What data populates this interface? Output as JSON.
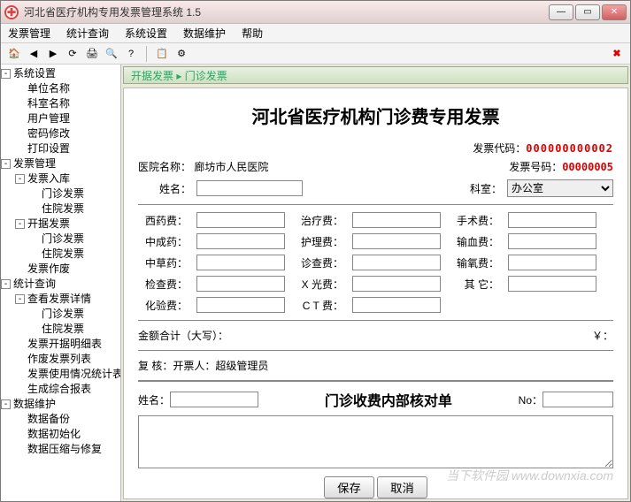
{
  "window": {
    "title": "河北省医疗机构专用发票管理系统 1.5",
    "icon_glyph": "✚"
  },
  "menu": [
    "发票管理",
    "统计查询",
    "系统设置",
    "数据维护",
    "帮助"
  ],
  "toolbar_icons": [
    "home-icon",
    "back-icon",
    "forward-icon",
    "refresh-icon",
    "print-icon",
    "find-icon",
    "help-icon",
    "sep",
    "tool-a",
    "tool-b"
  ],
  "close_icon_right": "✖",
  "tree": [
    {
      "lvl": 0,
      "label": "系统设置",
      "exp": "-"
    },
    {
      "lvl": 1,
      "label": "单位名称"
    },
    {
      "lvl": 1,
      "label": "科室名称"
    },
    {
      "lvl": 1,
      "label": "用户管理"
    },
    {
      "lvl": 1,
      "label": "密码修改"
    },
    {
      "lvl": 1,
      "label": "打印设置"
    },
    {
      "lvl": 0,
      "label": "发票管理",
      "exp": "-"
    },
    {
      "lvl": 1,
      "label": "发票入库",
      "exp": "-"
    },
    {
      "lvl": 2,
      "label": "门诊发票"
    },
    {
      "lvl": 2,
      "label": "住院发票"
    },
    {
      "lvl": 1,
      "label": "开据发票",
      "exp": "-"
    },
    {
      "lvl": 2,
      "label": "门诊发票"
    },
    {
      "lvl": 2,
      "label": "住院发票"
    },
    {
      "lvl": 1,
      "label": "发票作废"
    },
    {
      "lvl": 0,
      "label": "统计查询",
      "exp": "-"
    },
    {
      "lvl": 1,
      "label": "查看发票详情",
      "exp": "-"
    },
    {
      "lvl": 2,
      "label": "门诊发票"
    },
    {
      "lvl": 2,
      "label": "住院发票"
    },
    {
      "lvl": 1,
      "label": "发票开据明细表"
    },
    {
      "lvl": 1,
      "label": "作废发票列表"
    },
    {
      "lvl": 1,
      "label": "发票使用情况统计表"
    },
    {
      "lvl": 1,
      "label": "生成综合报表"
    },
    {
      "lvl": 0,
      "label": "数据维护",
      "exp": "-"
    },
    {
      "lvl": 1,
      "label": "数据备份"
    },
    {
      "lvl": 1,
      "label": "数据初始化"
    },
    {
      "lvl": 1,
      "label": "数据压缩与修复"
    }
  ],
  "breadcrumb": "开据发票 ▸ 门诊发票",
  "form": {
    "title": "河北省医疗机构门诊费专用发票",
    "invoice_code_lbl": "发票代码：",
    "invoice_code": "000000000002",
    "invoice_no_lbl": "发票号码：",
    "invoice_no": "00000005",
    "hospital_lbl": "医院名称：",
    "hospital": "廊坊市人民医院",
    "name_lbl": "姓名：",
    "dept_lbl": "科室：",
    "dept_value": "办公室",
    "fees_col1": [
      "西药费：",
      "中成药：",
      "中草药：",
      "检查费：",
      "化验费："
    ],
    "fees_col2": [
      "治疗费：",
      "护理费：",
      "诊查费：",
      "X 光费：",
      "C T 费："
    ],
    "fees_col3": [
      "手术费：",
      "输血费：",
      "输氧费：",
      "其  它："
    ],
    "total_lbl": "金额合计（大写）：",
    "total_currency": "￥：",
    "reviewer_lbl": "复  核：",
    "issuer_lbl": "开票人：",
    "issuer": "超级管理员",
    "section2_title": "门诊收费内部核对单",
    "section2_name_lbl": "姓名：",
    "section2_no_lbl": "No：",
    "save_btn": "保存",
    "cancel_btn": "取消"
  },
  "watermark": "当下软件园  www.downxia.com"
}
